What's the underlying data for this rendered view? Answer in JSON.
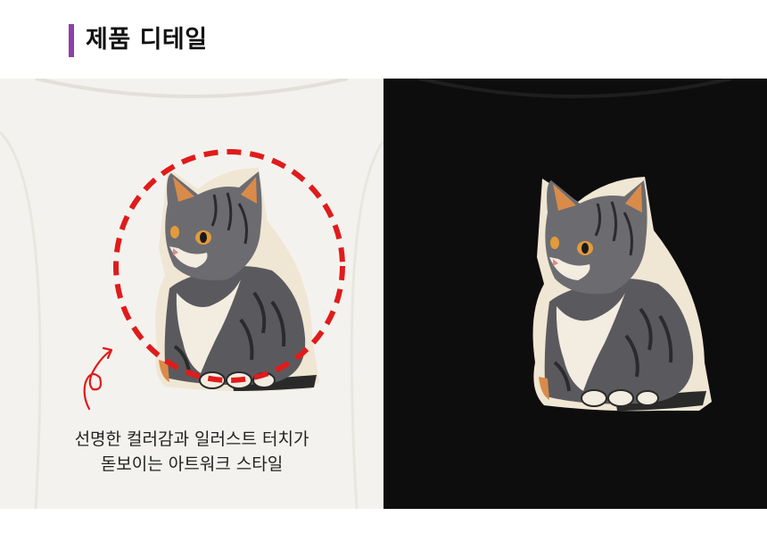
{
  "header": {
    "title": "제품 디테일",
    "accent_color": "#8e3fa8"
  },
  "panels": {
    "white_shirt": {
      "shirt_color": "#f4f2ee",
      "icon": "cat-print-icon"
    },
    "black_shirt": {
      "shirt_color": "#0d0d0d",
      "icon": "cat-print-icon"
    }
  },
  "highlight": {
    "circle_color": "#e01b1b",
    "arrow_icon": "curly-arrow-icon"
  },
  "caption": {
    "line1": "선명한 컬러감과 일러스트 터치가",
    "line2": "돋보이는 아트워크 스타일"
  }
}
